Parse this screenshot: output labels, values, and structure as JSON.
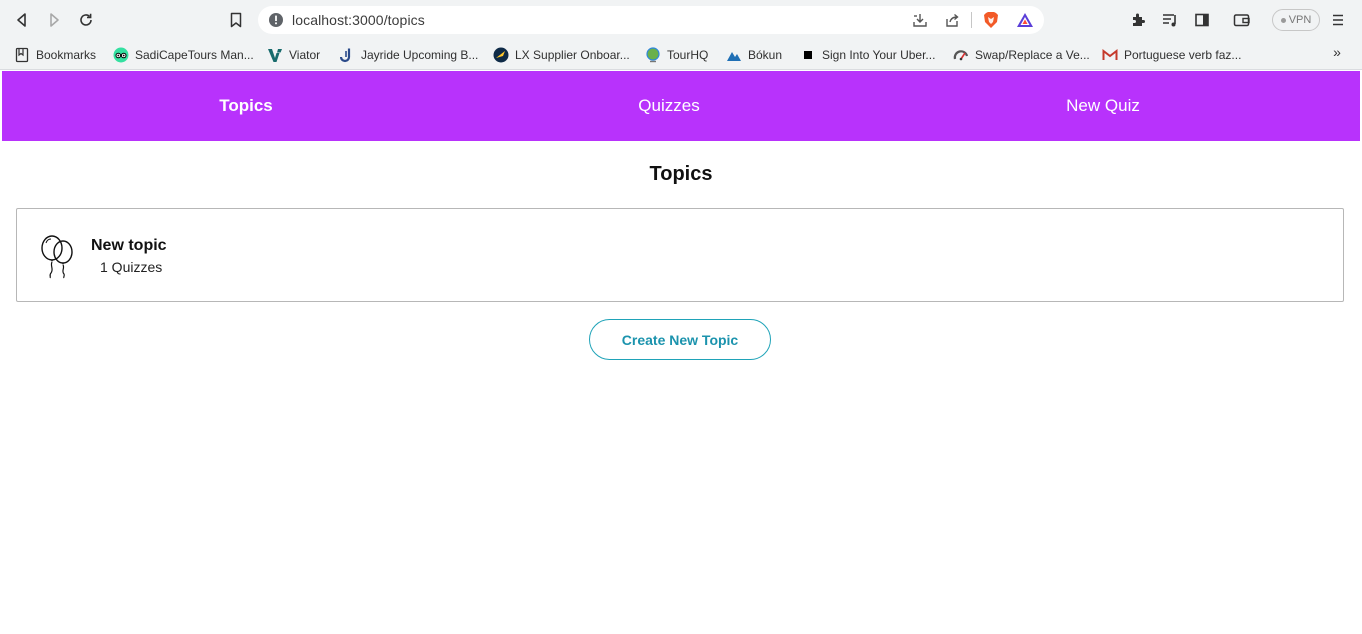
{
  "browser": {
    "url": "localhost:3000/topics",
    "vpn_label": "VPN",
    "icons": [
      "back-icon",
      "forward-icon",
      "reload-icon",
      "bookmark-page-icon",
      "site-info-icon",
      "install-app-icon",
      "share-icon",
      "brave-shields-icon",
      "brave-rewards-icon",
      "extensions-icon",
      "playlist-icon",
      "sidebar-icon",
      "wallet-icon",
      "menu-icon"
    ]
  },
  "bookmarks": [
    {
      "label": "Bookmarks",
      "icon": "bookmarks-folder-icon"
    },
    {
      "label": "SadiCapeTours Man...",
      "icon": "tripadvisor-icon"
    },
    {
      "label": "Viator",
      "icon": "viator-icon"
    },
    {
      "label": "Jayride Upcoming B...",
      "icon": "jayride-icon"
    },
    {
      "label": "LX Supplier Onboar...",
      "icon": "lx-icon"
    },
    {
      "label": "TourHQ",
      "icon": "tourhq-icon"
    },
    {
      "label": "Bókun",
      "icon": "bokun-icon"
    },
    {
      "label": "Sign Into Your Uber...",
      "icon": "uber-icon"
    },
    {
      "label": "Swap/Replace a Ve...",
      "icon": "swap-icon"
    },
    {
      "label": "Portuguese verb faz...",
      "icon": "gmail-icon"
    }
  ],
  "bookmarks_more": "»",
  "colors": {
    "nav_bg": "#b832fc",
    "button_border": "#1fa3b8",
    "button_text": "#1b93ad"
  },
  "nav": {
    "items": [
      {
        "label": "Topics",
        "active": true
      },
      {
        "label": "Quizzes",
        "active": false
      },
      {
        "label": "New Quiz",
        "active": false
      }
    ]
  },
  "page": {
    "title": "Topics",
    "topics": [
      {
        "name": "New topic",
        "quiz_count": "1 Quizzes",
        "icon": "balloons-icon"
      }
    ],
    "create_button_label": "Create New Topic"
  }
}
